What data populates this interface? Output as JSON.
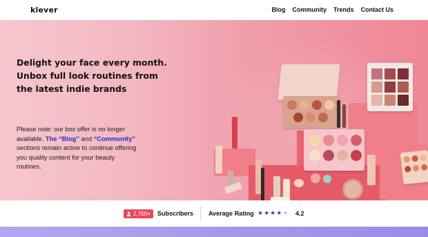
{
  "header": {
    "logo": "klever",
    "nav": [
      "Blog",
      "Community",
      "Trends",
      "Contact Us"
    ]
  },
  "hero": {
    "headline": "Delight your face every month. Unbox full look routines from the latest indie brands",
    "note_before": "Please note: our box offer is no longer available. ",
    "note_blog": "The “Blog”",
    "note_and": " and ",
    "note_community": "“Community”",
    "note_after": " sections remain active to continue offering you quality content for your beauty routines.",
    "image": "makeup-products-image"
  },
  "stats": {
    "subscribers_count": "2,750+",
    "subscribers_label": "Subscribers",
    "rating_label": "Average Rating",
    "rating_value": "4.2",
    "stars_filled": 4,
    "stars_total": 5
  },
  "colors": {
    "accent": "#e8485a",
    "link": "#1f2fbf",
    "star": "#3b4a8c",
    "footer": "#a999ec"
  }
}
